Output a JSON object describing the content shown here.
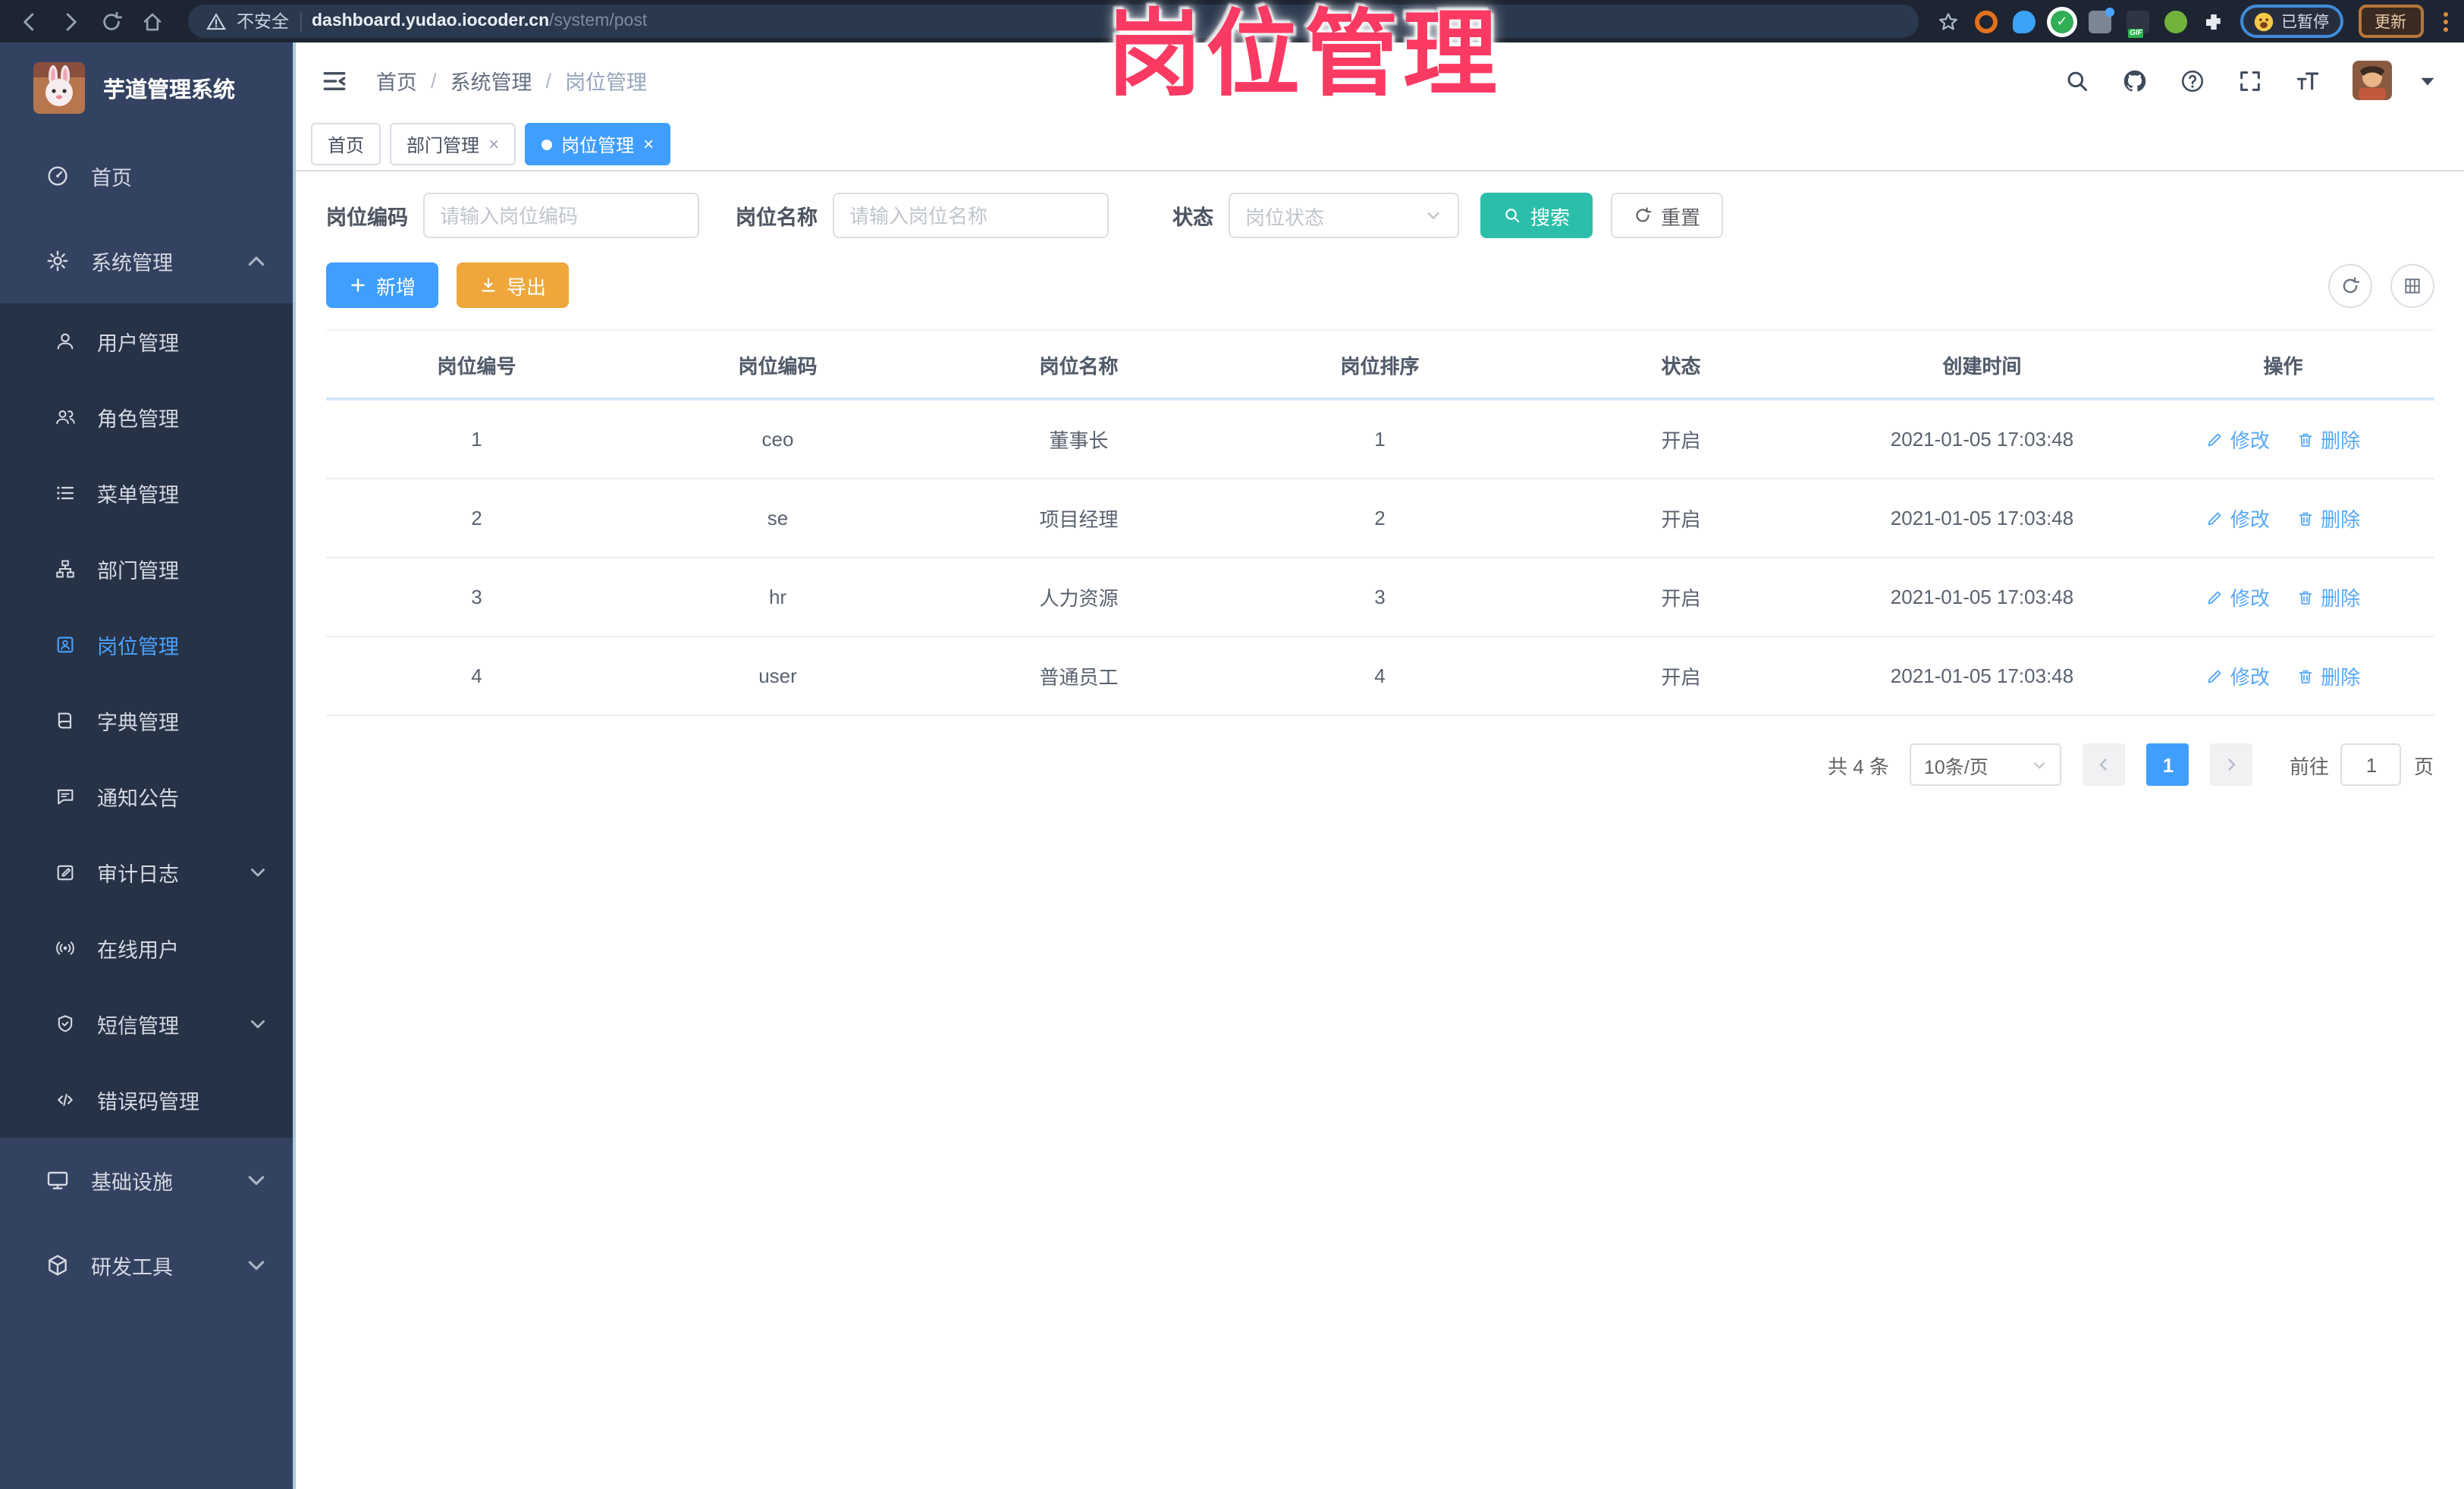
{
  "browser": {
    "security_label": "不安全",
    "url_domain": "dashboard.yudao.iocoder.cn",
    "url_path": "/system/post",
    "paused_badge": "已暂停",
    "update_button": "更新"
  },
  "overlay_title": "岗位管理",
  "sidebar": {
    "app_title": "芋道管理系统",
    "items": [
      {
        "label": "首页"
      },
      {
        "label": "系统管理"
      },
      {
        "label": "用户管理"
      },
      {
        "label": "角色管理"
      },
      {
        "label": "菜单管理"
      },
      {
        "label": "部门管理"
      },
      {
        "label": "岗位管理"
      },
      {
        "label": "字典管理"
      },
      {
        "label": "通知公告"
      },
      {
        "label": "审计日志"
      },
      {
        "label": "在线用户"
      },
      {
        "label": "短信管理"
      },
      {
        "label": "错误码管理"
      },
      {
        "label": "基础设施"
      },
      {
        "label": "研发工具"
      }
    ]
  },
  "header": {
    "breadcrumb": [
      "首页",
      "系统管理",
      "岗位管理"
    ],
    "icons": [
      "search-icon",
      "github-icon",
      "help-icon",
      "fullscreen-icon",
      "font-size-icon",
      "avatar",
      "caret-down-icon"
    ]
  },
  "tabs": [
    {
      "label": "首页"
    },
    {
      "label": "部门管理"
    },
    {
      "label": "岗位管理"
    }
  ],
  "filters": {
    "code_label": "岗位编码",
    "code_placeholder": "请输入岗位编码",
    "name_label": "岗位名称",
    "name_placeholder": "请输入岗位名称",
    "status_label": "状态",
    "status_placeholder": "岗位状态",
    "search_button": "搜索",
    "reset_button": "重置"
  },
  "toolbar": {
    "add_button": "新增",
    "export_button": "导出"
  },
  "table": {
    "headers": [
      "岗位编号",
      "岗位编码",
      "岗位名称",
      "岗位排序",
      "状态",
      "创建时间",
      "操作"
    ],
    "rows": [
      {
        "id": "1",
        "code": "ceo",
        "name": "董事长",
        "sort": "1",
        "status": "开启",
        "created": "2021-01-05 17:03:48"
      },
      {
        "id": "2",
        "code": "se",
        "name": "项目经理",
        "sort": "2",
        "status": "开启",
        "created": "2021-01-05 17:03:48"
      },
      {
        "id": "3",
        "code": "hr",
        "name": "人力资源",
        "sort": "3",
        "status": "开启",
        "created": "2021-01-05 17:03:48"
      },
      {
        "id": "4",
        "code": "user",
        "name": "普通员工",
        "sort": "4",
        "status": "开启",
        "created": "2021-01-05 17:03:48"
      }
    ],
    "edit_action": "修改",
    "delete_action": "删除"
  },
  "pagination": {
    "total": "共 4 条",
    "page_size": "10条/页",
    "current_page": "1",
    "goto_label": "前往",
    "goto_value": "1",
    "page_unit": "页"
  },
  "colors": {
    "primary": "#409eff",
    "search_teal": "#2bbfa9",
    "export_orange": "#efa73c",
    "overlay_pink": "#fb3a63",
    "sidebar_bg": "#344261",
    "submenu_bg": "#263246"
  }
}
